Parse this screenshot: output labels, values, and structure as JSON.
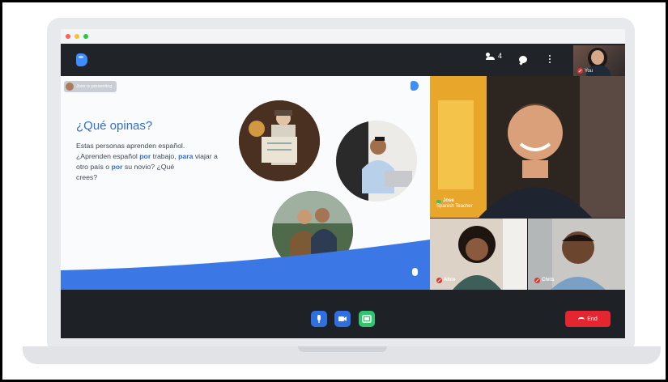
{
  "window": {
    "dots": [
      "#ff5f57",
      "#ffbd2e",
      "#28c840"
    ]
  },
  "appbar": {
    "participant_count": "4",
    "self_label": "You"
  },
  "presenter": {
    "text": "Jose is presenting"
  },
  "slide": {
    "title": "¿Qué opinas?",
    "line1": "Estas personas aprenden español.",
    "line2_a": "¿Aprenden español ",
    "line2_hl1": "por",
    "line2_b": " trabajo, ",
    "line2_hl2": "para",
    "line3_a": " viajar a otro país o ",
    "line3_hl": "por",
    "line3_b": " su novio? ¿Qué",
    "line4": "crees?"
  },
  "participants": {
    "main": {
      "name": "Jose",
      "role": "Spanish Teacher"
    },
    "p2": {
      "name": "Alice"
    },
    "p3": {
      "name": "Chris"
    }
  },
  "controls": {
    "end_label": "End",
    "mic_color": "#2f6fe0",
    "camera_color": "#2f6fe0",
    "present_color": "#2fc46e",
    "end_color": "#e3262f"
  }
}
